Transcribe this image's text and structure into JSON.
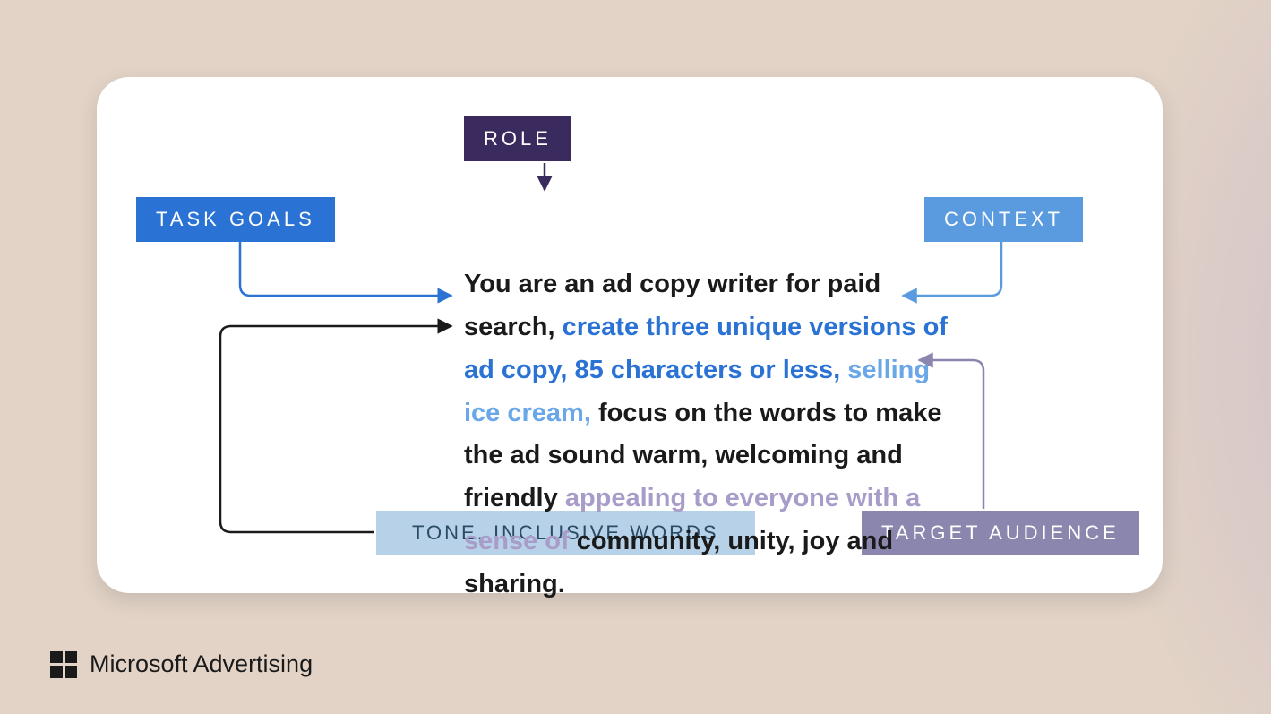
{
  "labels": {
    "role": "ROLE",
    "task_goals": "TASK GOALS",
    "context": "CONTEXT",
    "tone": "TONE, INCLUSIVE WORDS",
    "target": "TARGET AUDIENCE"
  },
  "prompt": {
    "role_segment": "You are an ad copy writer for paid search, ",
    "task_segment": "create three unique versions of ad copy, 85 characters or less, ",
    "context_segment": "selling ice cream, ",
    "tone_segment_a": "focus on the words to make the ad sound warm, welcoming and friendly ",
    "target_segment": "appealing to everyone with a sense of ",
    "tone_segment_b": "community, unity, joy and sharing."
  },
  "brand": "Microsoft Advertising",
  "colors": {
    "role": "#3a2a5e",
    "task_goals": "#2a72d4",
    "context": "#5a9be0",
    "tone": "#b7d2e8",
    "target": "#8b86ad"
  }
}
